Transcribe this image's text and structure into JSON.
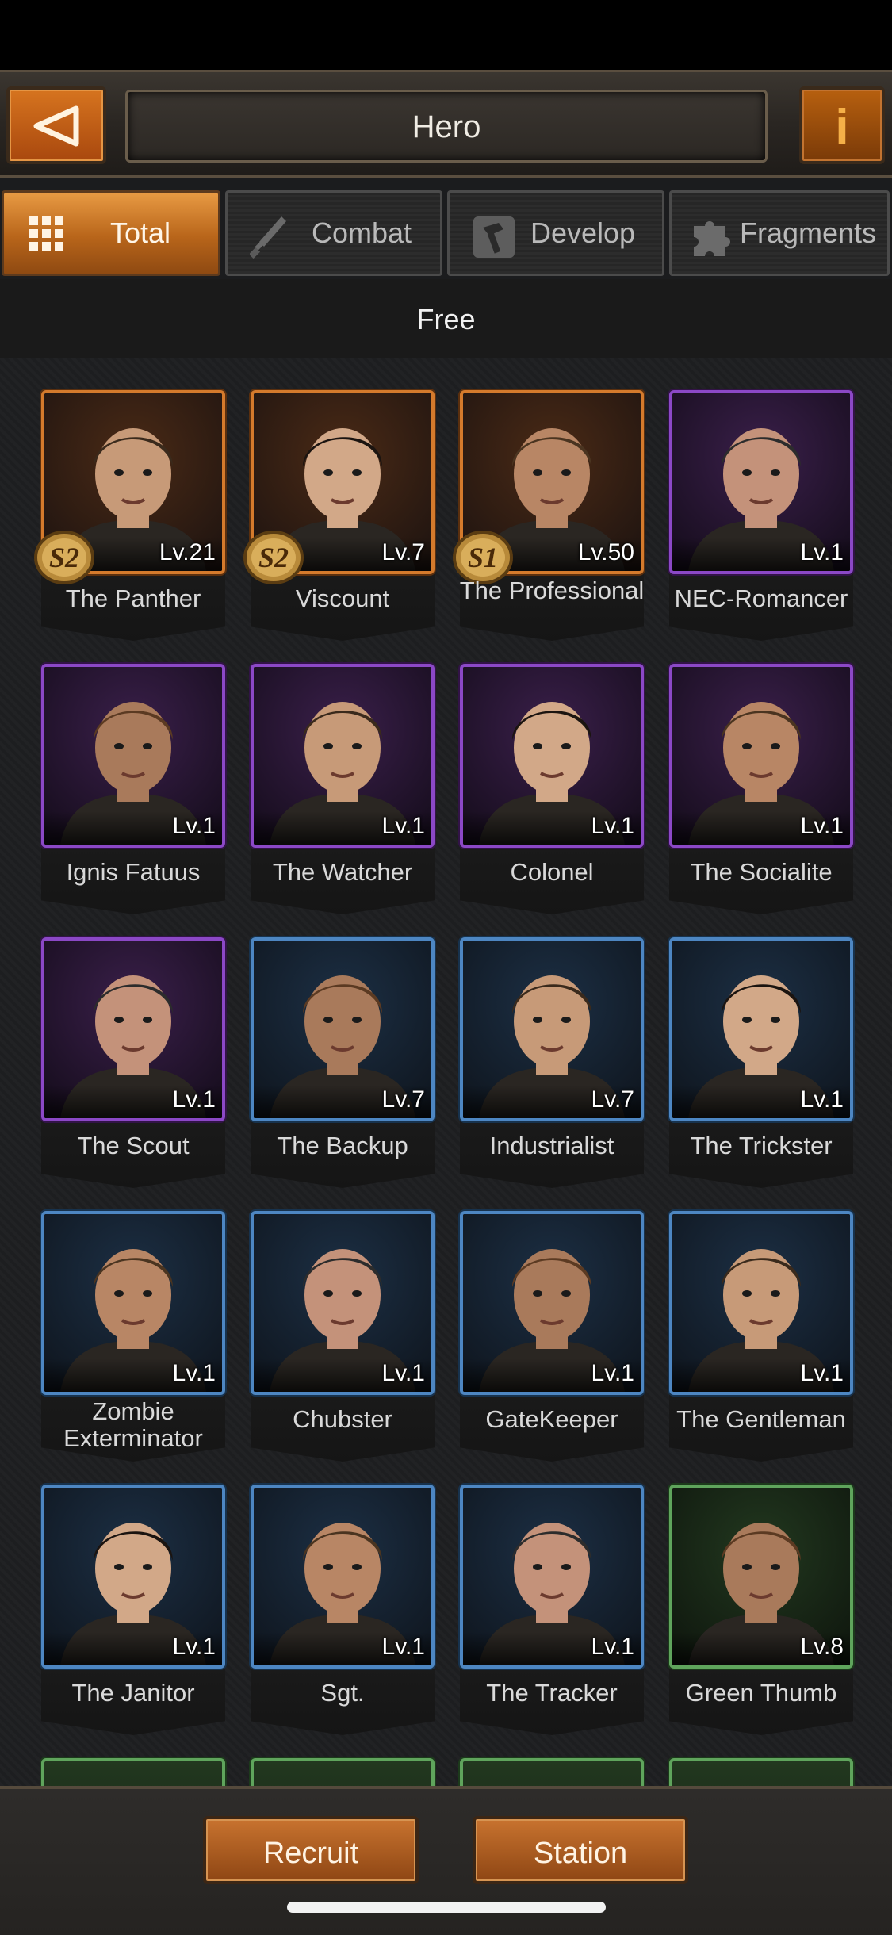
{
  "header": {
    "title": "Hero"
  },
  "tabs": [
    {
      "label": "Total",
      "icon": "grid-icon",
      "active": true
    },
    {
      "label": "Combat",
      "icon": "dagger-icon",
      "active": false
    },
    {
      "label": "Develop",
      "icon": "hammer-icon",
      "active": false
    },
    {
      "label": "Fragments",
      "icon": "puzzle-icon",
      "active": false
    }
  ],
  "section": {
    "label": "Free"
  },
  "heroes": [
    {
      "name": "The Panther",
      "level": "Lv.21",
      "season": "S2",
      "rarity": "orange"
    },
    {
      "name": "Viscount",
      "level": "Lv.7",
      "season": "S2",
      "rarity": "orange"
    },
    {
      "name": "The Professional",
      "level": "Lv.50",
      "season": "S1",
      "rarity": "orange"
    },
    {
      "name": "NEC-Romancer",
      "level": "Lv.1",
      "season": "",
      "rarity": "purple"
    },
    {
      "name": "Ignis Fatuus",
      "level": "Lv.1",
      "season": "",
      "rarity": "purple"
    },
    {
      "name": "The Watcher",
      "level": "Lv.1",
      "season": "",
      "rarity": "purple"
    },
    {
      "name": "Colonel",
      "level": "Lv.1",
      "season": "",
      "rarity": "purple"
    },
    {
      "name": "The Socialite",
      "level": "Lv.1",
      "season": "",
      "rarity": "purple"
    },
    {
      "name": "The Scout",
      "level": "Lv.1",
      "season": "",
      "rarity": "purple"
    },
    {
      "name": "The Backup",
      "level": "Lv.7",
      "season": "",
      "rarity": "blue"
    },
    {
      "name": "Industrialist",
      "level": "Lv.7",
      "season": "",
      "rarity": "blue"
    },
    {
      "name": "The Trickster",
      "level": "Lv.1",
      "season": "",
      "rarity": "blue"
    },
    {
      "name": "Zombie Exterminator",
      "level": "Lv.1",
      "season": "",
      "rarity": "blue"
    },
    {
      "name": "Chubster",
      "level": "Lv.1",
      "season": "",
      "rarity": "blue"
    },
    {
      "name": "GateKeeper",
      "level": "Lv.1",
      "season": "",
      "rarity": "blue"
    },
    {
      "name": "The Gentleman",
      "level": "Lv.1",
      "season": "",
      "rarity": "blue"
    },
    {
      "name": "The Janitor",
      "level": "Lv.1",
      "season": "",
      "rarity": "blue"
    },
    {
      "name": "Sgt.",
      "level": "Lv.1",
      "season": "",
      "rarity": "blue"
    },
    {
      "name": "The Tracker",
      "level": "Lv.1",
      "season": "",
      "rarity": "blue"
    },
    {
      "name": "Green Thumb",
      "level": "Lv.8",
      "season": "",
      "rarity": "green"
    }
  ],
  "partial_row_rarity": [
    "green",
    "green",
    "green",
    "green"
  ],
  "bottom": {
    "recruit_label": "Recruit",
    "station_label": "Station"
  },
  "colors": {
    "accent_orange": "#d47a2c",
    "rarity_orange": "#d47a2c",
    "rarity_purple": "#8b48c6",
    "rarity_blue": "#4d86c2",
    "rarity_green": "#5fa45c"
  }
}
